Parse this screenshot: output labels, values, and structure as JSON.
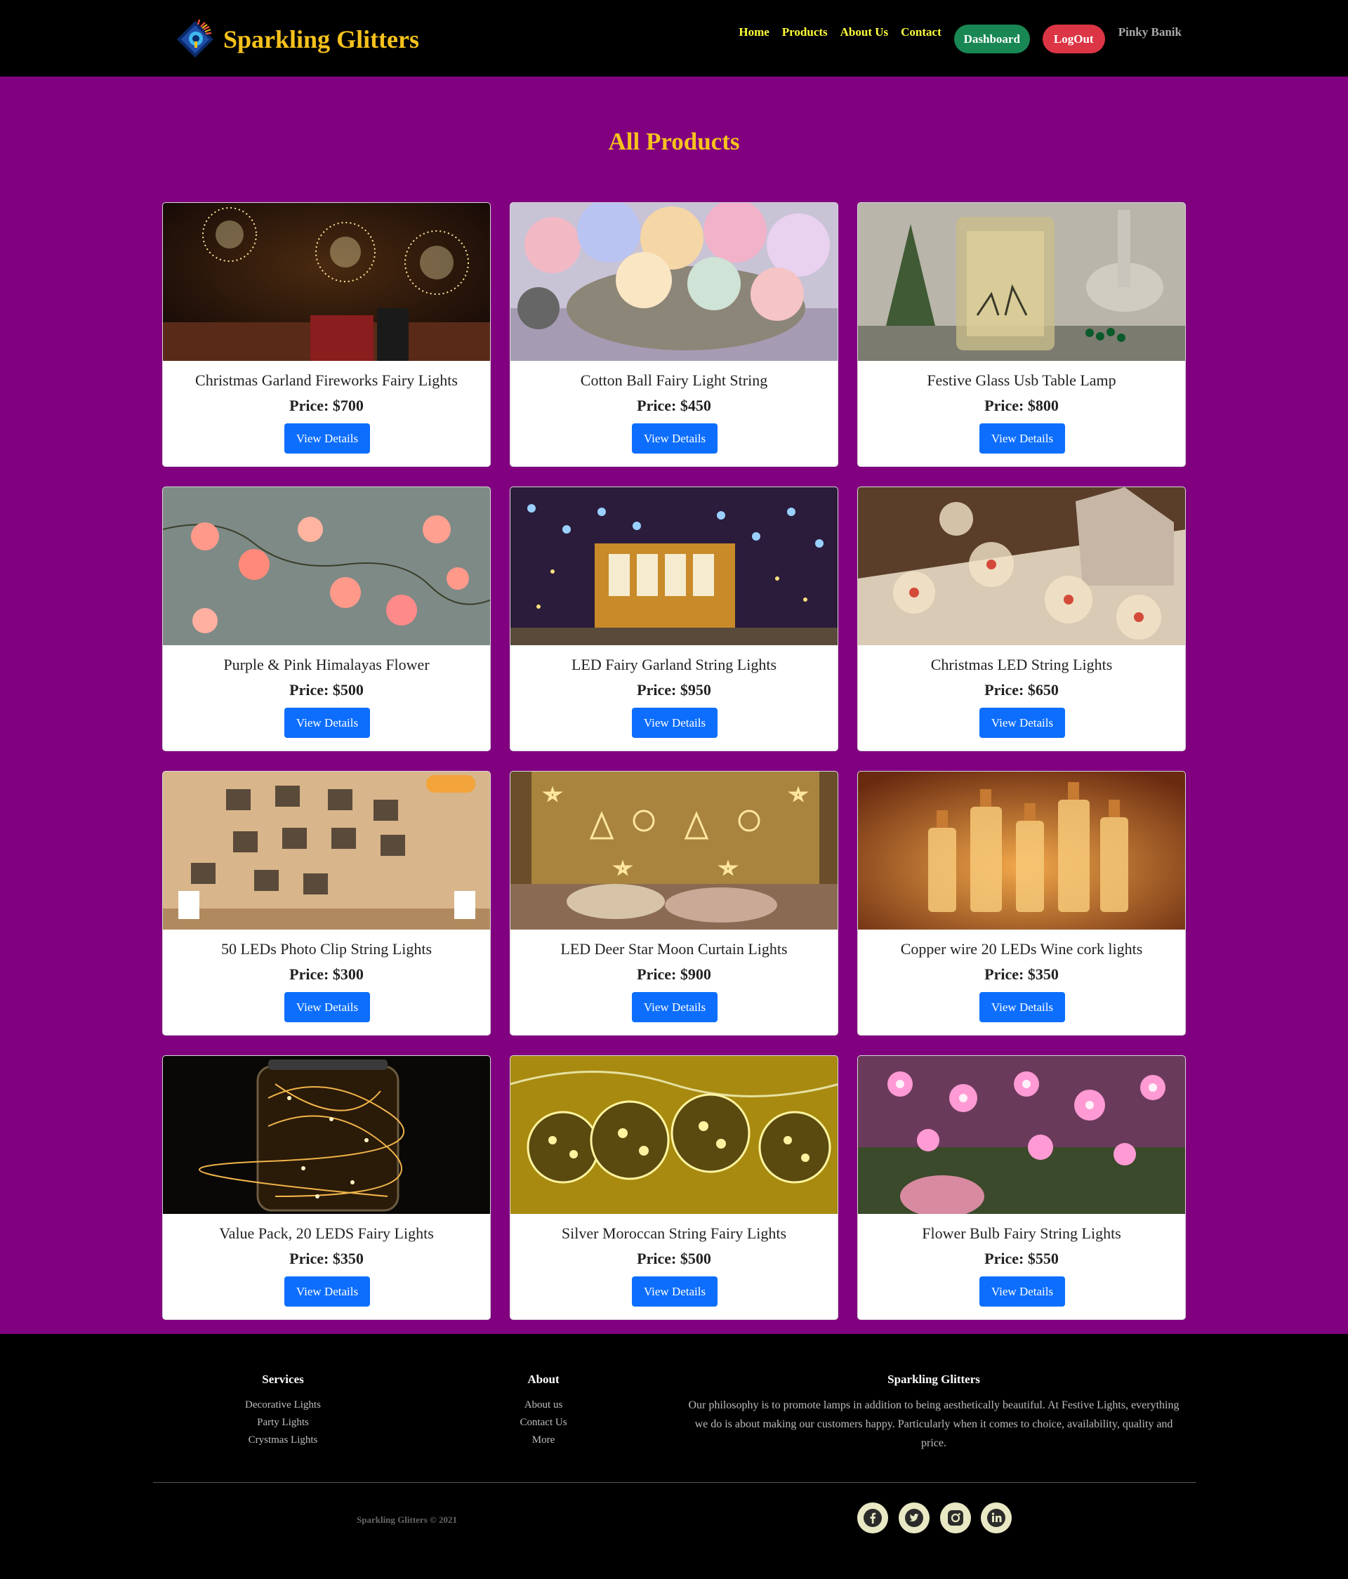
{
  "brand": {
    "name": "Sparkling Glitters",
    "colors": {
      "brand": "#f6c21c",
      "nav_link": "#ffff3b",
      "main_bg": "#800080",
      "primary": "#0d6efd",
      "success": "#198754",
      "danger": "#dc3545"
    }
  },
  "nav": {
    "home": "Home",
    "products": "Products",
    "about": "About Us",
    "contact": "Contact",
    "dashboard": "Dashboard",
    "logout": "LogOut",
    "user": "Pinky Banik"
  },
  "page": {
    "title": "All Products"
  },
  "products": [
    {
      "title": "Christmas Garland Fireworks Fairy Lights",
      "price": "Price: $700",
      "button": "View Details",
      "image": "fireworks-lights"
    },
    {
      "title": "Cotton Ball Fairy Light String",
      "price": "Price: $450",
      "button": "View Details",
      "image": "cotton-balls"
    },
    {
      "title": "Festive Glass Usb Table Lamp",
      "price": "Price: $800",
      "button": "View Details",
      "image": "glass-lamp"
    },
    {
      "title": "Purple & Pink Himalayas Flower",
      "price": "Price: $500",
      "button": "View Details",
      "image": "flower-lights"
    },
    {
      "title": "LED Fairy Garland String Lights",
      "price": "Price: $950",
      "button": "View Details",
      "image": "star-curtain"
    },
    {
      "title": "Christmas LED String Lights",
      "price": "Price: $650",
      "button": "View Details",
      "image": "globe-lights"
    },
    {
      "title": "50 LEDs Photo Clip String Lights",
      "price": "Price: $300",
      "button": "View Details",
      "image": "photo-clips"
    },
    {
      "title": "LED Deer Star Moon Curtain Lights",
      "price": "Price: $900",
      "button": "View Details",
      "image": "deer-star-curtain"
    },
    {
      "title": "Copper wire 20 LEDs Wine cork lights",
      "price": "Price: $350",
      "button": "View Details",
      "image": "wine-bottles"
    },
    {
      "title": "Value Pack, 20 LEDS Fairy Lights",
      "price": "Price: $350",
      "button": "View Details",
      "image": "jar-lights"
    },
    {
      "title": "Silver Moroccan String Fairy Lights",
      "price": "Price: $500",
      "button": "View Details",
      "image": "moroccan-balls"
    },
    {
      "title": "Flower Bulb Fairy String Lights",
      "price": "Price: $550",
      "button": "View Details",
      "image": "pink-flowers"
    }
  ],
  "footer": {
    "services": {
      "title": "Services",
      "links": [
        "Decorative Lights",
        "Party Lights",
        "Crystmas Lights"
      ]
    },
    "about": {
      "title": "About",
      "links": [
        "About us",
        "Contact Us",
        "More"
      ]
    },
    "company": {
      "title": "Sparkling Glitters",
      "text": "Our philosophy is to promote lamps in addition to being aesthetically beautiful. At Festive Lights, everything we do is about making our customers happy. Particularly when it comes to choice, availability, quality and price."
    },
    "copyright": "Sparkling Glitters © 2021",
    "social": [
      "facebook-icon",
      "twitter-icon",
      "instagram-icon",
      "linkedin-icon"
    ]
  }
}
